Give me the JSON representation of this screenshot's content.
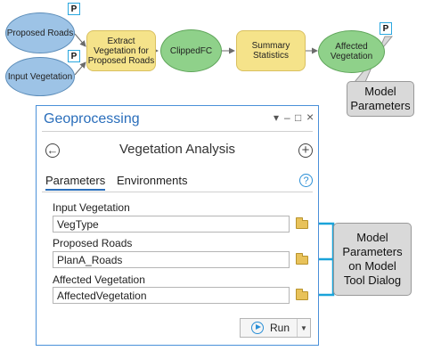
{
  "model": {
    "nodes": {
      "proposed_roads": "Proposed Roads",
      "input_vegetation": "Input Vegetation",
      "extract_tool": [
        "Extract",
        "Vegetation for",
        "Proposed Roads"
      ],
      "clipped_fc": "ClippedFC",
      "summary_statistics": [
        "Summary",
        "Statistics"
      ],
      "affected_vegetation": [
        "Affected",
        "Vegetation"
      ]
    },
    "parameter_badge": "P"
  },
  "callouts": {
    "model_parameters": [
      "Model",
      "Parameters"
    ],
    "model_parameters_dialog": [
      "Model",
      "Parameters",
      "on Model",
      "Tool Dialog"
    ]
  },
  "pane": {
    "title": "Geoprocessing",
    "controls": {
      "menu": "▾",
      "pin": "–",
      "maximize": "□",
      "close": "×"
    },
    "tool_title": "Vegetation Analysis",
    "back_icon": "←",
    "add_icon": "+",
    "tabs": {
      "parameters": "Parameters",
      "environments": "Environments"
    },
    "help_icon": "?",
    "fields": [
      {
        "label": "Input Vegetation",
        "value": "VegType"
      },
      {
        "label": "Proposed Roads",
        "value": "PlanA_Roads"
      },
      {
        "label": "Affected Vegetation",
        "value": "AffectedVegetation"
      }
    ],
    "run_label": "Run",
    "run_dropdown": "▼"
  },
  "colors": {
    "connector": "#1aa3d9",
    "accent": "#2a6ebb",
    "ellipse_blue": "#9dc3e6",
    "ellipse_green": "#8fd18a",
    "tool_yellow": "#f5e38a"
  }
}
